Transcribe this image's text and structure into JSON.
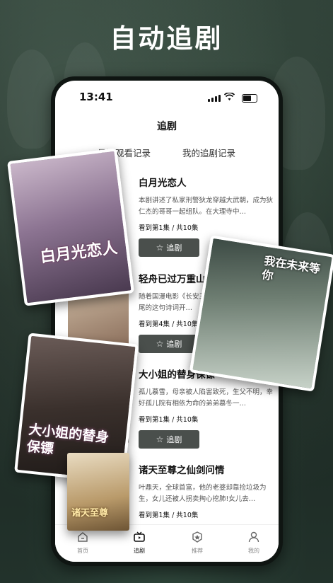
{
  "headline": "自动追剧",
  "status": {
    "time": "13:41"
  },
  "nav_title": "追剧",
  "tabs": [
    "最近观看记录",
    "我的追剧记录"
  ],
  "dramas": [
    {
      "title": "白月光恋人",
      "desc": "本剧讲述了私家刑警狄龙穿越大武朝，成为狄仁杰的哥哥一起组队。在大理寺中…",
      "progress": "看到第1集 / 共10集",
      "button": "追剧"
    },
    {
      "title": "轻舟已过万重山",
      "desc": "随着国漫电影《长安三万里》热映，在影片结尾的这句诗词开…",
      "progress": "看到第4集 / 共10集",
      "button": "追剧"
    },
    {
      "title": "大小姐的替身保镖",
      "desc": "孤儿慕雪，母亲被人陷害致死，生父不明，幸好孤儿院有相依为命的弟弟慕冬一…",
      "progress": "看到第1集 / 共10集",
      "button": "追剧"
    },
    {
      "title": "诸天至尊之仙剑问情",
      "desc": "叶鼎天，全球首富，他的老婆却靠捡垃圾为生，女儿还被人拐卖掏心挖肺!女儿去…",
      "progress": "看到第1集 / 共10集",
      "button": "追剧"
    }
  ],
  "bottom_nav": [
    "首页",
    "追剧",
    "推荐",
    "我的"
  ],
  "posters": {
    "p1": "白月光恋人",
    "p2": "我在未来等你",
    "p3": "大小姐的替身保镖",
    "p4": "诸天至尊"
  },
  "colors": {
    "button_bg": "#4a4f4c",
    "background": "#1d2a24"
  }
}
